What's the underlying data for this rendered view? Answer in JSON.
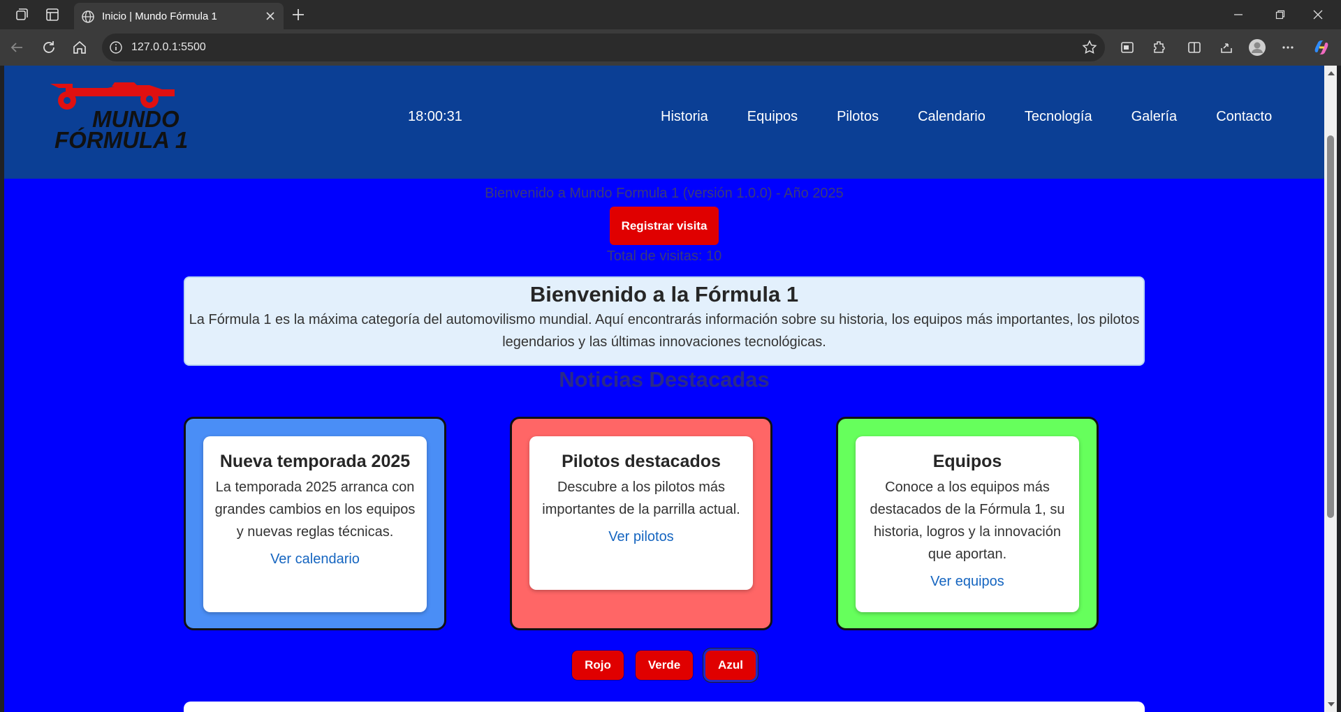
{
  "browser": {
    "tab_title": "Inicio | Mundo Fórmula 1",
    "url": "127.0.0.1:5500"
  },
  "site": {
    "logo_line1": "MUNDO",
    "logo_line2": "FÓRMULA 1",
    "clock": "18:00:31",
    "nav": [
      "Historia",
      "Equipos",
      "Pilotos",
      "Calendario",
      "Tecnología",
      "Galería",
      "Contacto"
    ],
    "welcome_line": "Bienvenido a Mundo Formula 1 (versión 1.0.0) - Año 2025",
    "register_button": "Registrar visita",
    "visits": "Total de visitas: 10",
    "intro": {
      "title": "Bienvenido a la Fórmula 1",
      "text": "La Fórmula 1 es la máxima categoría del automovilismo mundial. Aquí encontrarás información sobre su historia, los equipos más importantes, los pilotos legendarios y las últimas innovaciones tecnológicas."
    },
    "news_title": "Noticias Destacadas",
    "cards": [
      {
        "title": "Nueva temporada 2025",
        "text": "La temporada 2025 arranca con grandes cambios en los equipos y nuevas reglas técnicas.",
        "link": "Ver calendario",
        "color": "#4a8ef6"
      },
      {
        "title": "Pilotos destacados",
        "text": "Descubre a los pilotos más importantes de la parrilla actual.",
        "link": "Ver pilotos",
        "color": "#ff6666"
      },
      {
        "title": "Equipos",
        "text": "Conoce a los equipos más destacados de la Fórmula 1, su historia, logros y la innovación que aportan.",
        "link": "Ver equipos",
        "color": "#66ff5c"
      }
    ],
    "color_buttons": [
      "Rojo",
      "Verde",
      "Azul"
    ],
    "active_color": "Azul"
  },
  "colors": {
    "page_bg": "#0000fe",
    "header_bg": "#0b3f95",
    "accent_red": "#e00000"
  }
}
